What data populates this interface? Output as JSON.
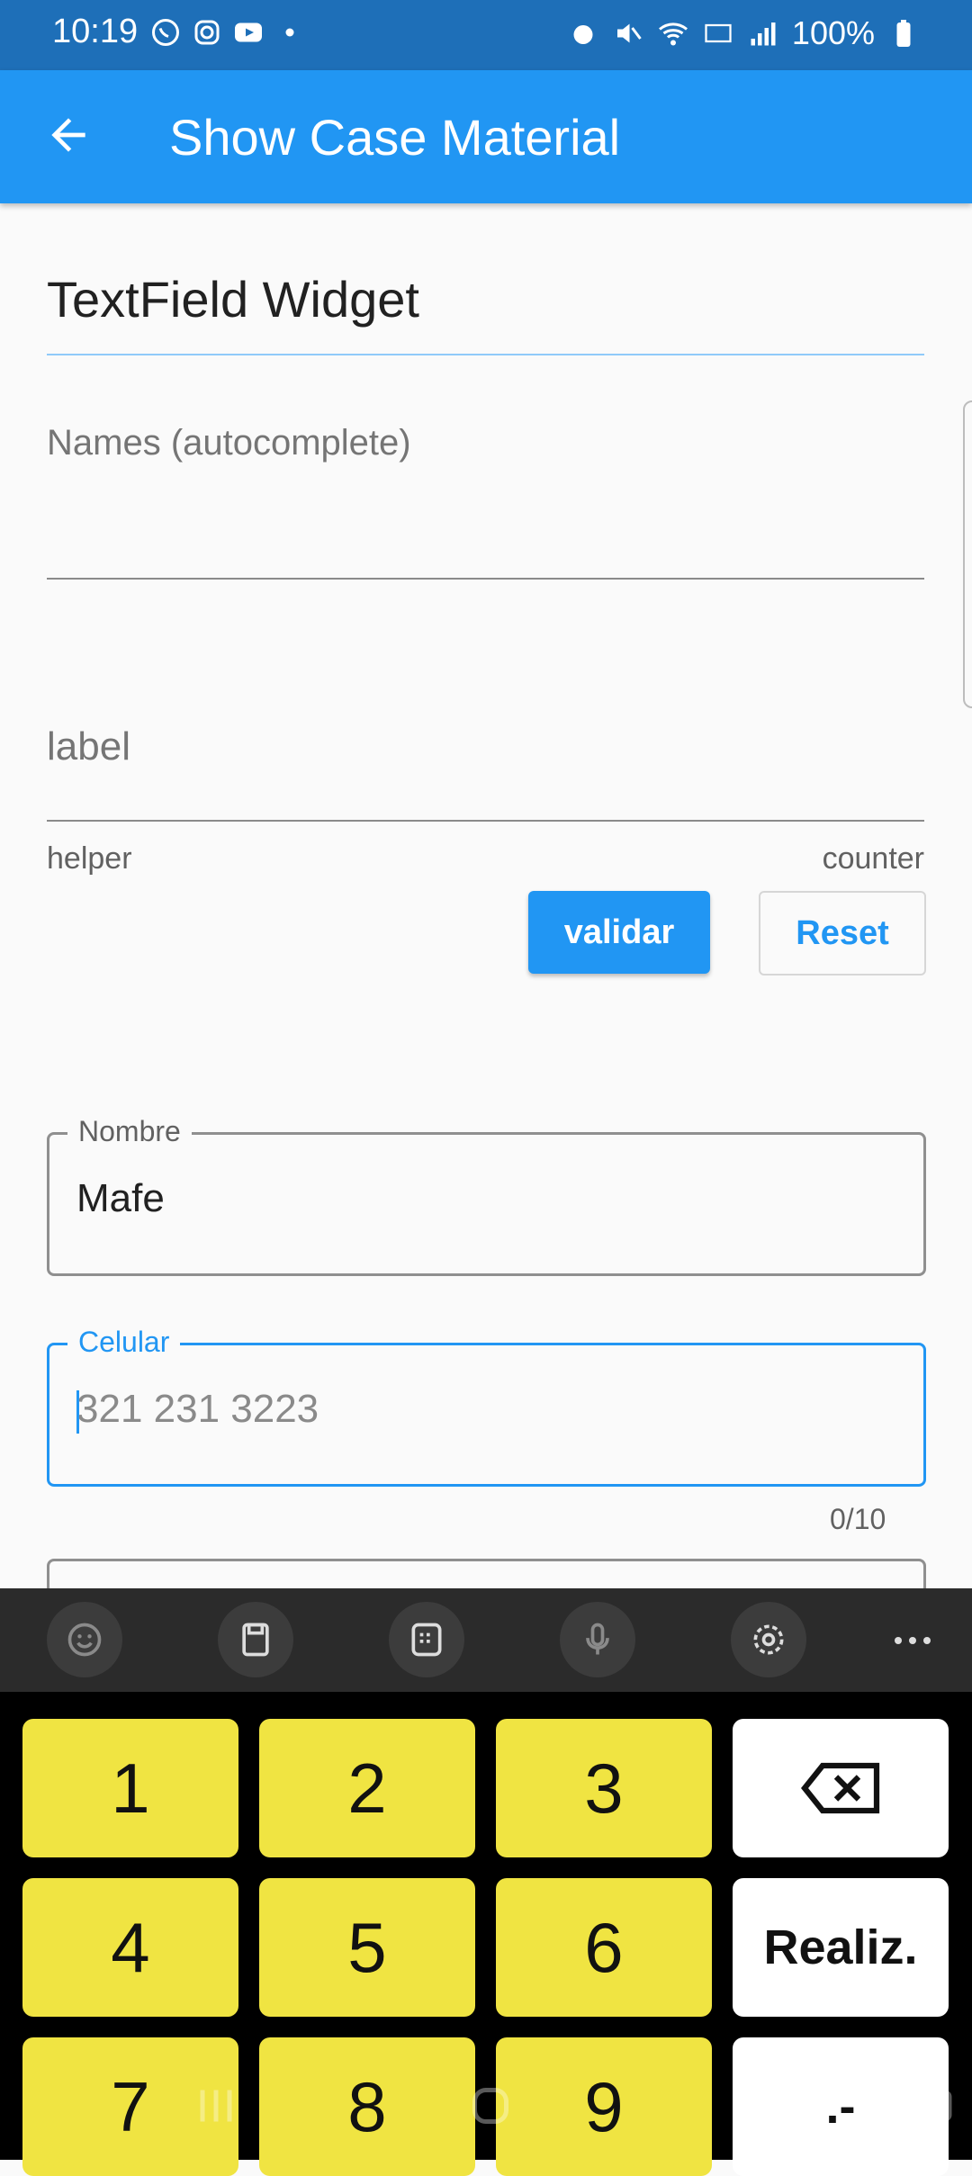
{
  "status_bar": {
    "time": "10:19",
    "battery": "100%",
    "left_icons": [
      "whatsapp-icon",
      "instagram-icon",
      "youtube-icon",
      "dot-icon"
    ],
    "right_icons": [
      "alarm-icon",
      "mute-icon",
      "wifi-icon",
      "lte-icon",
      "signal-icon",
      "battery-icon"
    ]
  },
  "app_bar": {
    "title": "Show Case Material",
    "background": "#2196f3"
  },
  "content": {
    "section_title": "TextField Widget",
    "names_field": {
      "label": "Names (autocomplete)"
    },
    "label_field": {
      "label": "label",
      "helper": "helper",
      "counter": "counter"
    },
    "buttons": {
      "validar": "validar",
      "reset": "Reset"
    },
    "nombre_field": {
      "label": "Nombre",
      "value": "Mafe"
    },
    "celular_field": {
      "label": "Celular",
      "placeholder": "321 231 3223",
      "counter": "0/10"
    }
  },
  "keyboard": {
    "toolbar_icons": [
      "emoji-icon",
      "clipboard-icon",
      "keypad-icon",
      "mic-icon",
      "settings-icon",
      "more-icon"
    ],
    "rows": [
      [
        "1",
        "2",
        "3"
      ],
      [
        "4",
        "5",
        "6"
      ],
      [
        "7",
        "8",
        "9"
      ]
    ],
    "done_label": "Realiz.",
    "symbols_label": ".-",
    "accent": "#f0e442"
  }
}
